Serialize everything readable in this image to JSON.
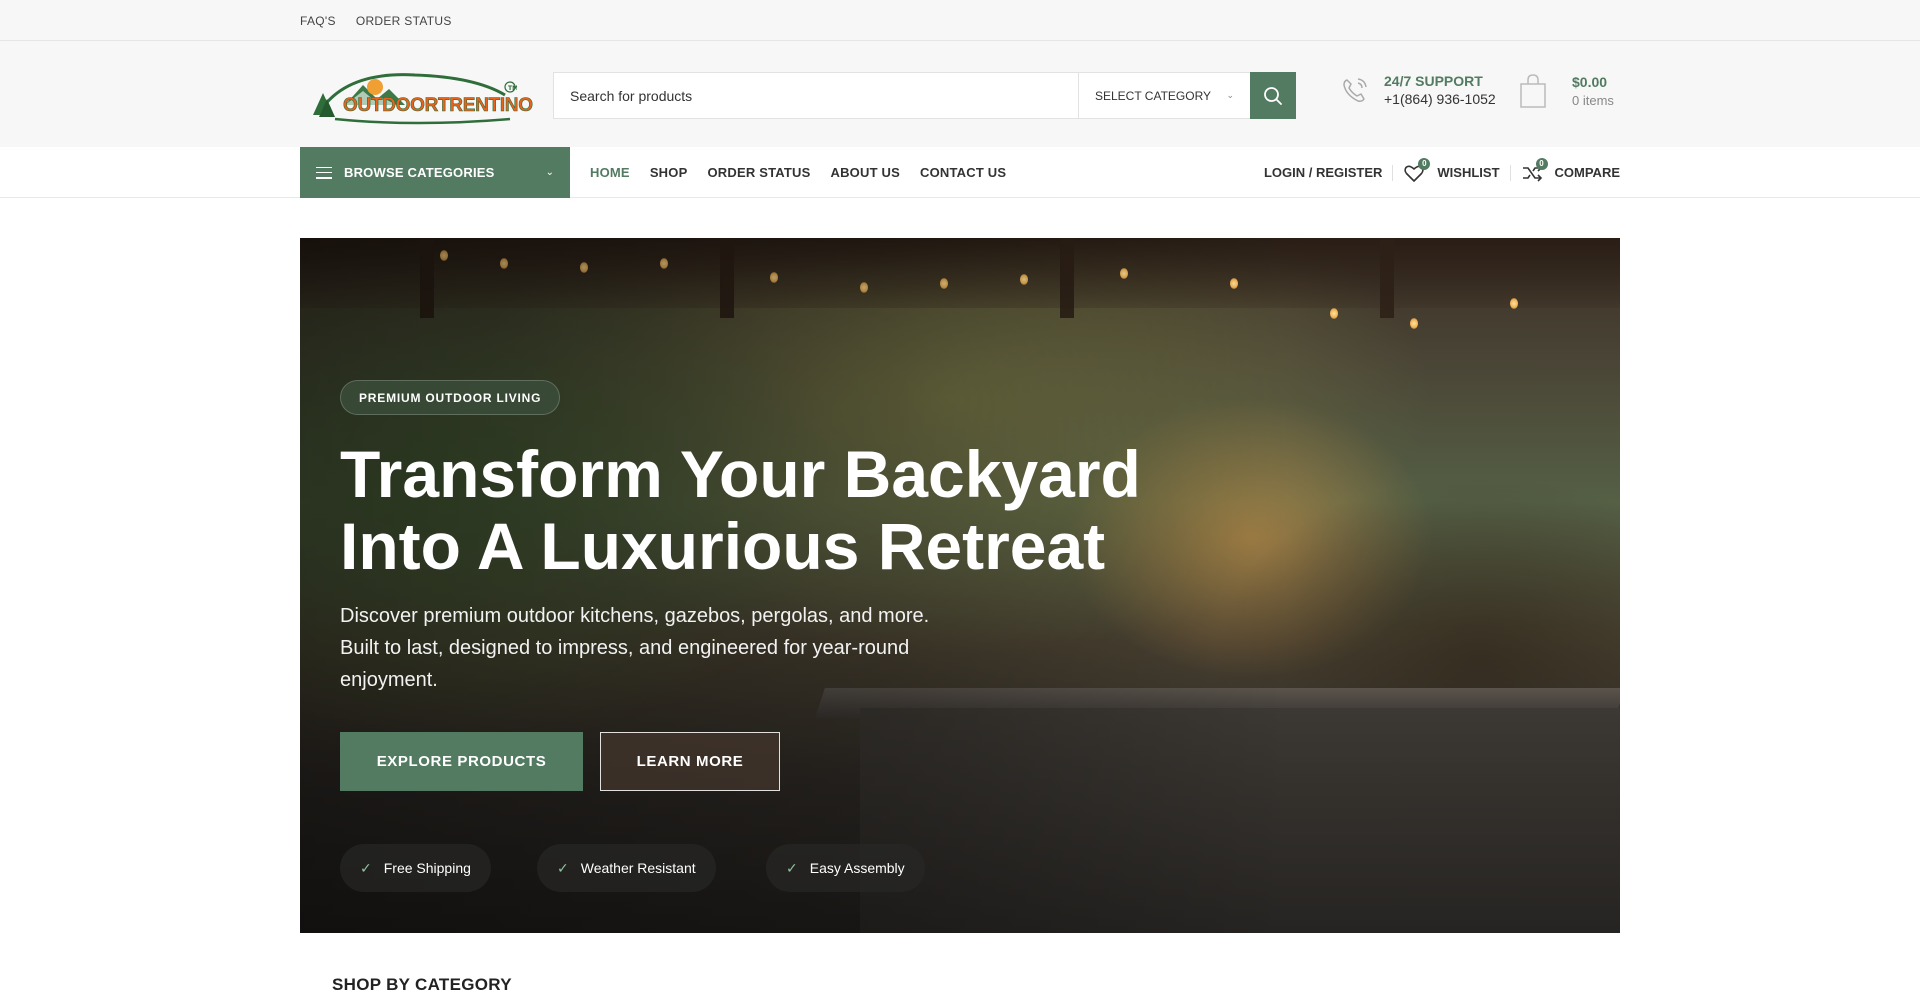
{
  "topbar": {
    "links": [
      "FAQ'S",
      "ORDER STATUS"
    ]
  },
  "header": {
    "logo_text": "OUTDOORTRENTINO",
    "search": {
      "placeholder": "Search for products",
      "category": "SELECT CATEGORY"
    },
    "support": {
      "title": "24/7 SUPPORT",
      "phone": "+1(864) 936-1052"
    },
    "cart": {
      "amount": "$0.00",
      "items": "0 items"
    }
  },
  "nav": {
    "browse_label": "BROWSE CATEGORIES",
    "menu": [
      "HOME",
      "SHOP",
      "ORDER STATUS",
      "ABOUT US",
      "CONTACT US"
    ],
    "active": "HOME",
    "login": "LOGIN / REGISTER",
    "wishlist": {
      "label": "WISHLIST",
      "count": "0"
    },
    "compare": {
      "label": "COMPARE",
      "count": "0"
    }
  },
  "hero": {
    "badge": "PREMIUM OUTDOOR LIVING",
    "title_line1": "Transform Your Backyard",
    "title_line2": "Into A Luxurious Retreat",
    "description": "Discover premium outdoor kitchens, gazebos, pergolas, and more. Built to last, designed to impress, and engineered for year-round enjoyment.",
    "primary_cta": "EXPLORE PRODUCTS",
    "secondary_cta": "LEARN MORE",
    "features": [
      "Free Shipping",
      "Weather Resistant",
      "Easy Assembly"
    ]
  },
  "sections": {
    "shop_by_category": "SHOP BY CATEGORY"
  },
  "colors": {
    "accent": "#527b62",
    "accent_dark": "#3f5f4b",
    "logo_orange": "#e8631c"
  }
}
